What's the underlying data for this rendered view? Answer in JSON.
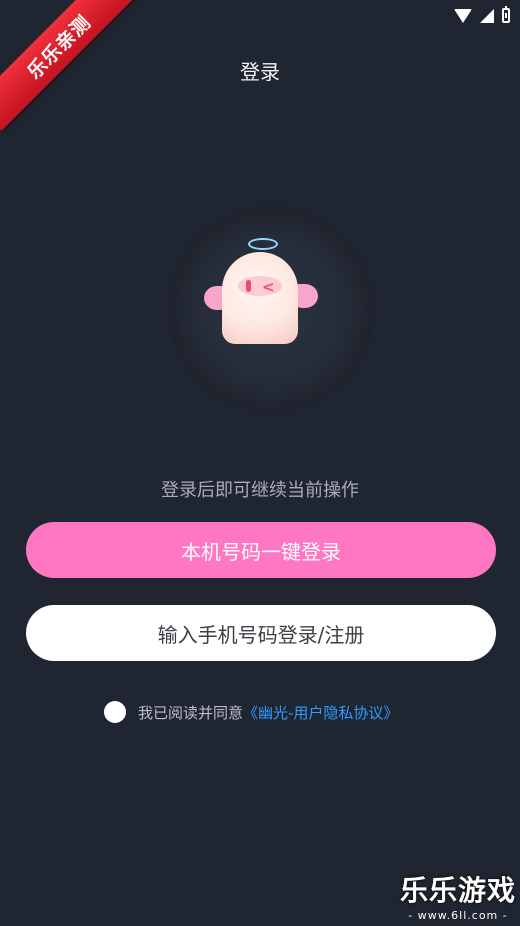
{
  "status_bar": {
    "icons": [
      "wifi-icon",
      "signal-icon",
      "battery-icon"
    ]
  },
  "watermark": {
    "ribbon_text": "乐乐亲测",
    "brand_name": "乐乐游戏",
    "brand_url": "- www.6ll.com -"
  },
  "header": {
    "title": "登录",
    "back_icon": "back-chevron-icon"
  },
  "illustration": {
    "name": "ghost-mascot"
  },
  "main": {
    "hint": "登录后即可继续当前操作",
    "primary_button": "本机号码一键登录",
    "secondary_button": "输入手机号码登录/注册"
  },
  "agreement": {
    "checked": false,
    "text": "我已阅读并同意",
    "link": "《幽光-用户隐私协议》"
  },
  "colors": {
    "background": "#202631",
    "primary_button": "#ff76c2",
    "link": "#2e9bff"
  }
}
